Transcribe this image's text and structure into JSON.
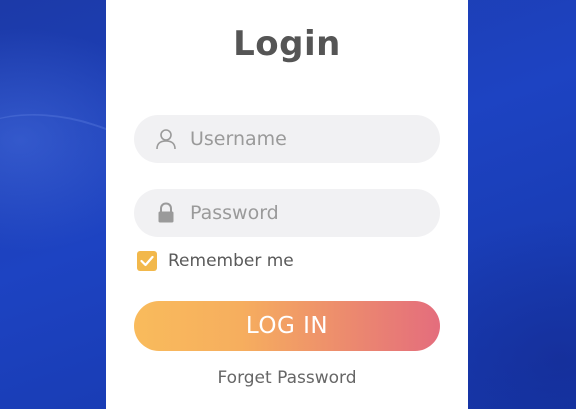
{
  "login_card": {
    "title": "Login",
    "username": {
      "placeholder": "Username",
      "value": "",
      "icon": "user-icon"
    },
    "password": {
      "placeholder": "Password",
      "value": "",
      "icon": "lock-icon"
    },
    "remember": {
      "label": "Remember me",
      "checked": true
    },
    "login_button_label": "LOG IN",
    "forget_password_label": "Forget Password"
  },
  "colors": {
    "background": "#1a3fb7",
    "card": "#ffffff",
    "input_bg": "#f1f1f3",
    "checkbox": "#f2b84b",
    "button_gradient_start": "#f9bb5c",
    "button_gradient_end": "#e46d7d"
  }
}
